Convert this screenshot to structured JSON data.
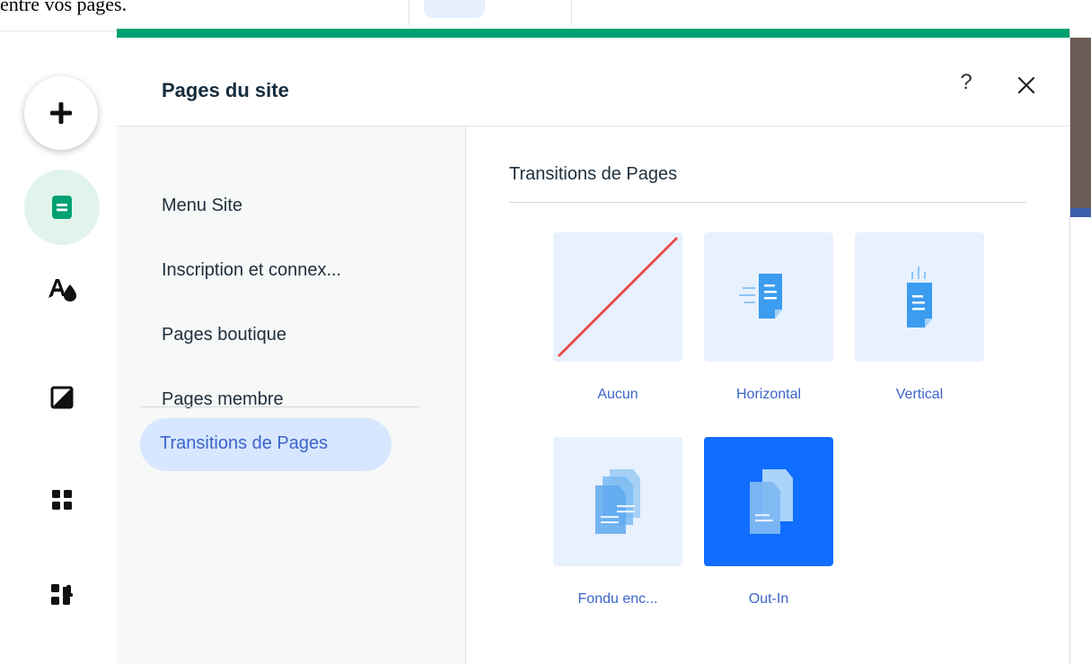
{
  "top": {
    "partial_text": "entre vos pages."
  },
  "rail": {
    "items": [
      {
        "name": "add",
        "icon": "plus-icon"
      },
      {
        "name": "pages",
        "icon": "page-icon"
      },
      {
        "name": "design",
        "icon": "theme-drop-icon"
      },
      {
        "name": "background",
        "icon": "half-square-icon"
      },
      {
        "name": "apps",
        "icon": "grid-icon"
      },
      {
        "name": "app-market",
        "icon": "puzzle-icon"
      }
    ]
  },
  "panel": {
    "title": "Pages du site",
    "help_label": "?",
    "accent_color": "#00a173"
  },
  "nav": {
    "items": [
      {
        "label": "Menu Site"
      },
      {
        "label": "Inscription et connex..."
      },
      {
        "label": "Pages boutique"
      },
      {
        "label": "Pages membre"
      }
    ],
    "active_label": "Transitions de Pages"
  },
  "content": {
    "section_title": "Transitions de Pages",
    "transitions": [
      {
        "label": "Aucun",
        "icon": "none-slash-icon",
        "selected": false
      },
      {
        "label": "Horizontal",
        "icon": "horizontal-page-icon",
        "selected": false
      },
      {
        "label": "Vertical",
        "icon": "vertical-page-icon",
        "selected": false
      },
      {
        "label": "Fondu enc...",
        "icon": "crossfade-pages-icon",
        "selected": false
      },
      {
        "label": "Out-In",
        "icon": "out-in-pages-icon",
        "selected": true
      }
    ],
    "selected_color": "#116dff"
  }
}
